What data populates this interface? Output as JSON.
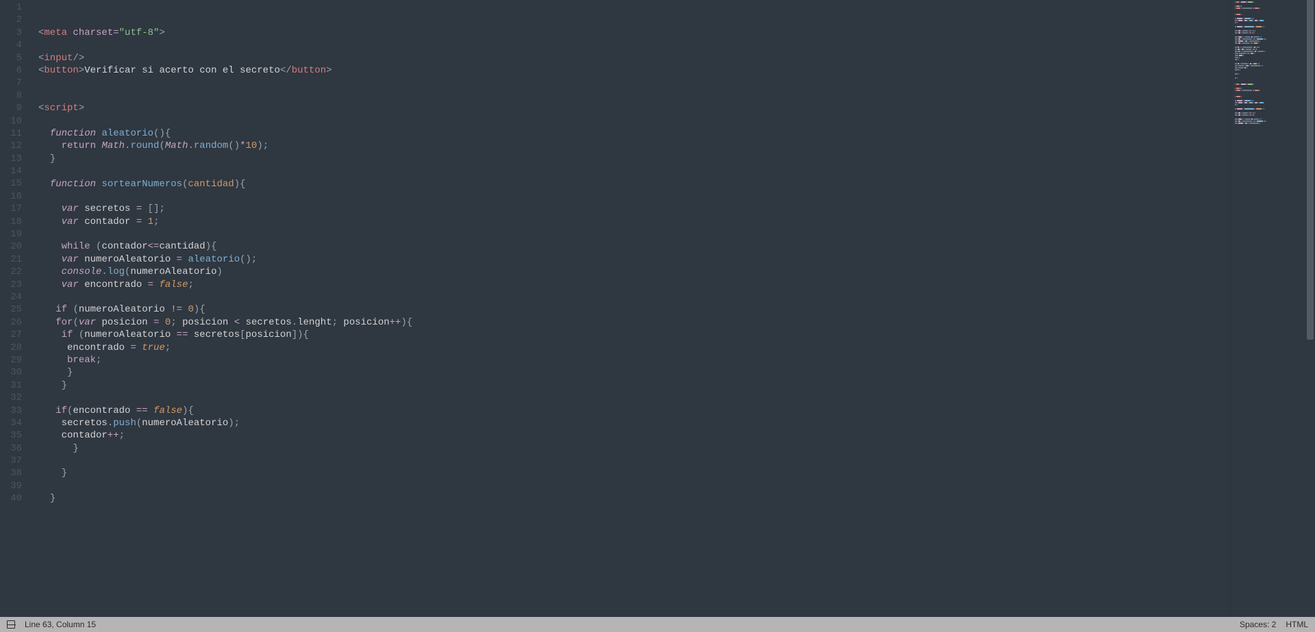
{
  "statusbar": {
    "cursor": "Line 63, Column 15",
    "spaces": "Spaces: 2",
    "syntax": "HTML"
  },
  "gutter": {
    "start": 1,
    "end": 40
  },
  "code": {
    "lines": [
      [
        [
          "tag-angle",
          "<"
        ],
        [
          "tag-name",
          "meta"
        ],
        [
          "default",
          " "
        ],
        [
          "attr-name",
          "charset"
        ],
        [
          "op",
          "="
        ],
        [
          "string",
          "\"utf-8\""
        ],
        [
          "tag-angle",
          ">"
        ]
      ],
      [],
      [
        [
          "tag-angle",
          "<"
        ],
        [
          "tag-name",
          "input"
        ],
        [
          "tag-angle",
          "/>"
        ]
      ],
      [
        [
          "tag-angle",
          "<"
        ],
        [
          "tag-name",
          "button"
        ],
        [
          "tag-angle",
          ">"
        ],
        [
          "default",
          "Verificar si acerto con el secreto"
        ],
        [
          "tag-angle",
          "</"
        ],
        [
          "tag-name",
          "button"
        ],
        [
          "tag-angle",
          ">"
        ]
      ],
      [],
      [],
      [
        [
          "tag-angle",
          "<"
        ],
        [
          "tag-name",
          "script"
        ],
        [
          "tag-angle",
          ">"
        ]
      ],
      [],
      [
        [
          "default",
          "  "
        ],
        [
          "kw-storage",
          "function"
        ],
        [
          "default",
          " "
        ],
        [
          "fn-decl",
          "aleatorio"
        ],
        [
          "punct",
          "()"
        ],
        [
          "punct",
          "{"
        ]
      ],
      [
        [
          "default",
          "    "
        ],
        [
          "kw-flow",
          "return"
        ],
        [
          "default",
          " "
        ],
        [
          "obj",
          "Math"
        ],
        [
          "punct",
          "."
        ],
        [
          "fn-call",
          "round"
        ],
        [
          "punct",
          "("
        ],
        [
          "obj",
          "Math"
        ],
        [
          "punct",
          "."
        ],
        [
          "fn-call",
          "random"
        ],
        [
          "punct",
          "()"
        ],
        [
          "op",
          "*"
        ],
        [
          "num",
          "10"
        ],
        [
          "punct",
          ")"
        ],
        [
          "punct",
          ";"
        ]
      ],
      [
        [
          "default",
          "  "
        ],
        [
          "punct",
          "}"
        ]
      ],
      [],
      [
        [
          "default",
          "  "
        ],
        [
          "kw-storage",
          "function"
        ],
        [
          "default",
          " "
        ],
        [
          "fn-decl",
          "sortearNumeros"
        ],
        [
          "punct",
          "("
        ],
        [
          "param",
          "cantidad"
        ],
        [
          "punct",
          ")"
        ],
        [
          "punct",
          "{"
        ]
      ],
      [],
      [
        [
          "default",
          "    "
        ],
        [
          "kw-storage",
          "var"
        ],
        [
          "default",
          " "
        ],
        [
          "ident",
          "secretos"
        ],
        [
          "default",
          " "
        ],
        [
          "op",
          "="
        ],
        [
          "default",
          " "
        ],
        [
          "punct",
          "[]"
        ],
        [
          "punct",
          ";"
        ]
      ],
      [
        [
          "default",
          "    "
        ],
        [
          "kw-storage",
          "var"
        ],
        [
          "default",
          " "
        ],
        [
          "ident",
          "contador"
        ],
        [
          "default",
          " "
        ],
        [
          "op",
          "="
        ],
        [
          "default",
          " "
        ],
        [
          "num",
          "1"
        ],
        [
          "punct",
          ";"
        ]
      ],
      [],
      [
        [
          "default",
          "    "
        ],
        [
          "kw-flow",
          "while"
        ],
        [
          "default",
          " "
        ],
        [
          "punct",
          "("
        ],
        [
          "ident",
          "contador"
        ],
        [
          "op",
          "<="
        ],
        [
          "ident",
          "cantidad"
        ],
        [
          "punct",
          ")"
        ],
        [
          "punct",
          "{"
        ]
      ],
      [
        [
          "default",
          "    "
        ],
        [
          "kw-storage",
          "var"
        ],
        [
          "default",
          " "
        ],
        [
          "ident",
          "numeroAleatorio"
        ],
        [
          "default",
          " "
        ],
        [
          "op",
          "="
        ],
        [
          "default",
          " "
        ],
        [
          "fn-call",
          "aleatorio"
        ],
        [
          "punct",
          "()"
        ],
        [
          "punct",
          ";"
        ]
      ],
      [
        [
          "default",
          "    "
        ],
        [
          "obj",
          "console"
        ],
        [
          "punct",
          "."
        ],
        [
          "fn-call",
          "log"
        ],
        [
          "punct",
          "("
        ],
        [
          "ident",
          "numeroAleatorio"
        ],
        [
          "punct",
          ")"
        ]
      ],
      [
        [
          "default",
          "    "
        ],
        [
          "kw-storage",
          "var"
        ],
        [
          "default",
          " "
        ],
        [
          "ident",
          "encontrado"
        ],
        [
          "default",
          " "
        ],
        [
          "op",
          "="
        ],
        [
          "default",
          " "
        ],
        [
          "bool",
          "false"
        ],
        [
          "punct",
          ";"
        ]
      ],
      [],
      [
        [
          "default",
          "   "
        ],
        [
          "kw-flow",
          "if"
        ],
        [
          "default",
          " "
        ],
        [
          "punct",
          "("
        ],
        [
          "ident",
          "numeroAleatorio"
        ],
        [
          "default",
          " "
        ],
        [
          "op",
          "!="
        ],
        [
          "default",
          " "
        ],
        [
          "num",
          "0"
        ],
        [
          "punct",
          ")"
        ],
        [
          "punct",
          "{"
        ]
      ],
      [
        [
          "default",
          "   "
        ],
        [
          "kw-flow",
          "for"
        ],
        [
          "punct",
          "("
        ],
        [
          "kw-storage",
          "var"
        ],
        [
          "default",
          " "
        ],
        [
          "ident",
          "posicion"
        ],
        [
          "default",
          " "
        ],
        [
          "op",
          "="
        ],
        [
          "default",
          " "
        ],
        [
          "num",
          "0"
        ],
        [
          "punct",
          ";"
        ],
        [
          "default",
          " "
        ],
        [
          "ident",
          "posicion"
        ],
        [
          "default",
          " "
        ],
        [
          "op",
          "<"
        ],
        [
          "default",
          " "
        ],
        [
          "ident",
          "secretos"
        ],
        [
          "punct",
          "."
        ],
        [
          "ident",
          "lenght"
        ],
        [
          "punct",
          ";"
        ],
        [
          "default",
          " "
        ],
        [
          "ident",
          "posicion"
        ],
        [
          "op",
          "++"
        ],
        [
          "punct",
          ")"
        ],
        [
          "punct",
          "{"
        ]
      ],
      [
        [
          "default",
          "    "
        ],
        [
          "kw-flow",
          "if"
        ],
        [
          "default",
          " "
        ],
        [
          "punct",
          "("
        ],
        [
          "ident",
          "numeroAleatorio"
        ],
        [
          "default",
          " "
        ],
        [
          "op",
          "=="
        ],
        [
          "default",
          " "
        ],
        [
          "ident",
          "secretos"
        ],
        [
          "punct",
          "["
        ],
        [
          "ident",
          "posicion"
        ],
        [
          "punct",
          "]"
        ],
        [
          "punct",
          ")"
        ],
        [
          "punct",
          "{"
        ]
      ],
      [
        [
          "default",
          "     "
        ],
        [
          "ident",
          "encontrado"
        ],
        [
          "default",
          " "
        ],
        [
          "op",
          "="
        ],
        [
          "default",
          " "
        ],
        [
          "bool",
          "true"
        ],
        [
          "punct",
          ";"
        ]
      ],
      [
        [
          "default",
          "     "
        ],
        [
          "kw-flow",
          "break"
        ],
        [
          "punct",
          ";"
        ]
      ],
      [
        [
          "default",
          "     "
        ],
        [
          "punct",
          "}"
        ]
      ],
      [
        [
          "default",
          "    "
        ],
        [
          "punct",
          "}"
        ]
      ],
      [],
      [
        [
          "default",
          "   "
        ],
        [
          "kw-flow",
          "if"
        ],
        [
          "punct",
          "("
        ],
        [
          "ident",
          "encontrado"
        ],
        [
          "default",
          " "
        ],
        [
          "op",
          "=="
        ],
        [
          "default",
          " "
        ],
        [
          "bool",
          "false"
        ],
        [
          "punct",
          ")"
        ],
        [
          "punct",
          "{"
        ]
      ],
      [
        [
          "default",
          "    "
        ],
        [
          "ident",
          "secretos"
        ],
        [
          "punct",
          "."
        ],
        [
          "fn-call",
          "push"
        ],
        [
          "punct",
          "("
        ],
        [
          "ident",
          "numeroAleatorio"
        ],
        [
          "punct",
          ")"
        ],
        [
          "punct",
          ";"
        ]
      ],
      [
        [
          "default",
          "    "
        ],
        [
          "ident",
          "contador"
        ],
        [
          "op",
          "++"
        ],
        [
          "punct",
          ";"
        ]
      ],
      [
        [
          "default",
          "      "
        ],
        [
          "punct",
          "}"
        ]
      ],
      [],
      [
        [
          "default",
          "    "
        ],
        [
          "punct",
          "}"
        ]
      ],
      [],
      [
        [
          "default",
          "  "
        ],
        [
          "punct",
          "}"
        ]
      ],
      [],
      []
    ]
  },
  "minimap": {
    "colors": {
      "tag": "#d37f7f",
      "kw": "#c5a5c5",
      "fn": "#7fb0d1",
      "str": "#8fc28f",
      "num": "#d19a66",
      "def": "#6b7785"
    }
  }
}
